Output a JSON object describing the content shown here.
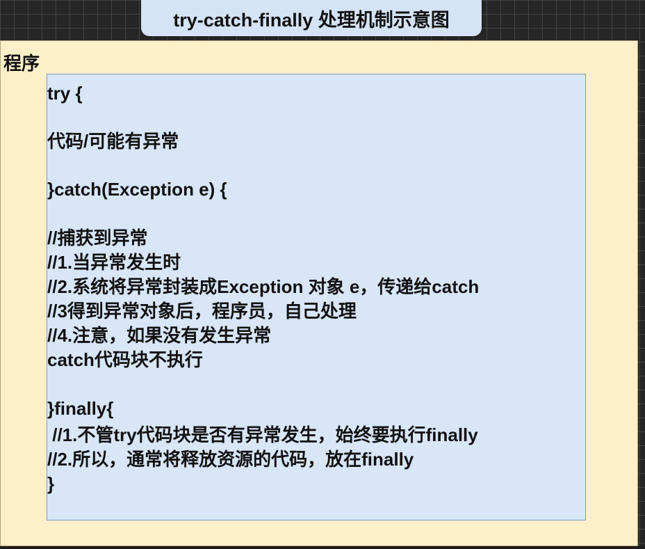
{
  "title": "try-catch-finally 处理机制示意图",
  "program_label": "程序",
  "code_lines": [
    {
      "id": "line-try",
      "text": "try {"
    },
    {
      "id": "line-code",
      "text": "代码/可能有异常"
    },
    {
      "id": "line-catch",
      "text": "}catch(Exception e) {"
    },
    {
      "id": "line-c1",
      "text": "//捕获到异常"
    },
    {
      "id": "line-c2",
      "text": "//1.当异常发生时"
    },
    {
      "id": "line-c3",
      "text": "//2.系统将异常封装成Exception 对象 e，传递给catch"
    },
    {
      "id": "line-c4",
      "text": "//3得到异常对象后，程序员，自己处理"
    },
    {
      "id": "line-c5",
      "text": "//4.注意，如果没有发生异常"
    },
    {
      "id": "line-c6",
      "text": "catch代码块不执行"
    },
    {
      "id": "line-finally",
      "text": "}finally{"
    },
    {
      "id": "line-f1",
      "text": " //1.不管try代码块是否有异常发生，始终要执行finally"
    },
    {
      "id": "line-f2",
      "text": "//2.所以，通常将释放资源的代码，放在finally"
    },
    {
      "id": "line-close",
      "text": "}"
    }
  ]
}
